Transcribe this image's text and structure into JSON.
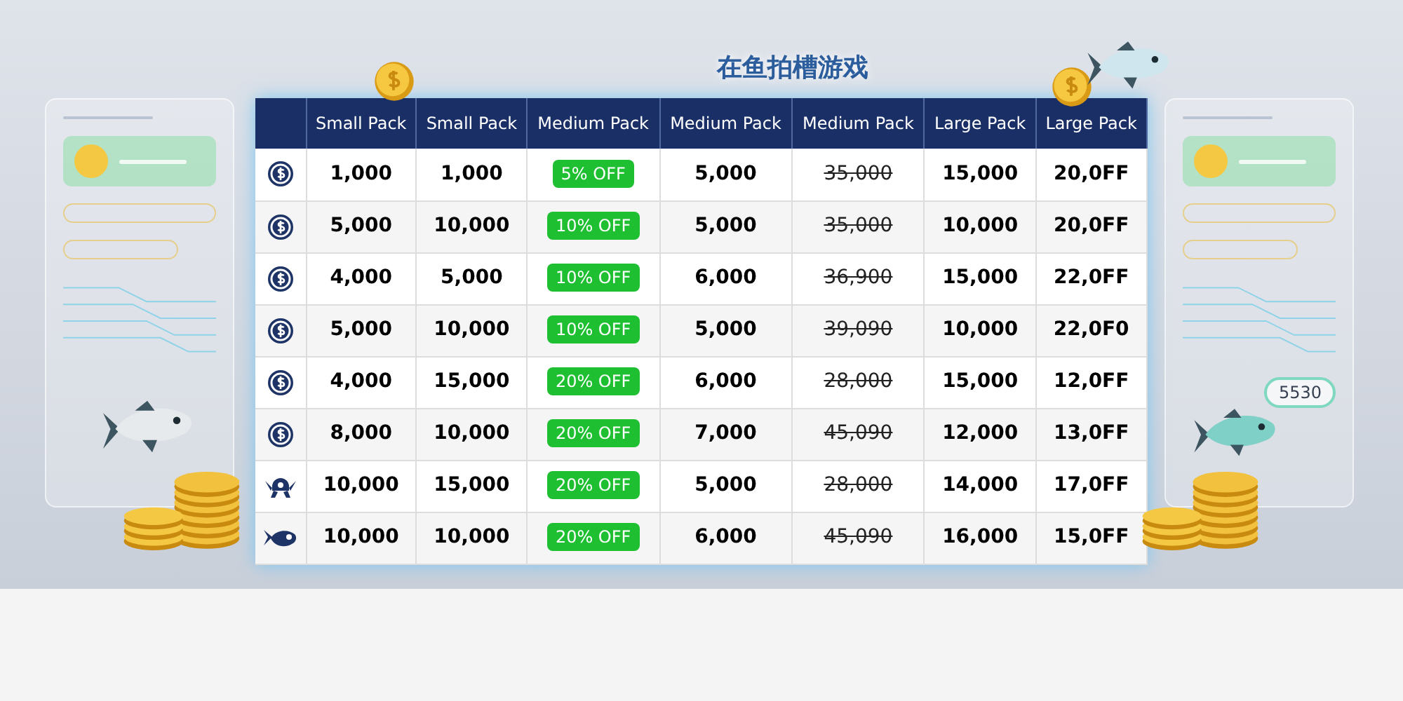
{
  "title": "在鱼拍槽游戏",
  "columns": [
    "Small Pack",
    "Small Pack",
    "Medium Pack",
    "Medium Pack",
    "Medium Pack",
    "Large Pack",
    "Large Pack"
  ],
  "rows": [
    {
      "kind": "coin",
      "small_1": "1,000",
      "small_2": "1,000",
      "discount": "5% OFF",
      "medium": "5,000",
      "medium_old": "35,000",
      "large_1": "15,000",
      "large_2": "20,0FF"
    },
    {
      "kind": "coin",
      "small_1": "5,000",
      "small_2": "10,000",
      "discount": "10% OFF",
      "medium": "5,000",
      "medium_old": "35,000",
      "large_1": "10,000",
      "large_2": "20,0FF"
    },
    {
      "kind": "coin",
      "small_1": "4,000",
      "small_2": "5,000",
      "discount": "10% OFF",
      "medium": "6,000",
      "medium_old": "36,900",
      "large_1": "15,000",
      "large_2": "22,0FF"
    },
    {
      "kind": "coin",
      "small_1": "5,000",
      "small_2": "10,000",
      "discount": "10% OFF",
      "medium": "5,000",
      "medium_old": "39,090",
      "large_1": "10,000",
      "large_2": "22,0F0"
    },
    {
      "kind": "coin",
      "small_1": "4,000",
      "small_2": "15,000",
      "discount": "20% OFF",
      "medium": "6,000",
      "medium_old": "28,000",
      "large_1": "15,000",
      "large_2": "12,0FF"
    },
    {
      "kind": "coin",
      "small_1": "8,000",
      "small_2": "10,000",
      "discount": "20% OFF",
      "medium": "7,000",
      "medium_old": "45,090",
      "large_1": "12,000",
      "large_2": "13,0FF"
    },
    {
      "kind": "creature",
      "small_1": "10,000",
      "small_2": "15,000",
      "discount": "20% OFF",
      "medium": "5,000",
      "medium_old": "28,000",
      "large_1": "14,000",
      "large_2": "17,0FF"
    },
    {
      "kind": "fish",
      "small_1": "10,000",
      "small_2": "10,000",
      "discount": "20% OFF",
      "medium": "6,000",
      "medium_old": "45,090",
      "large_1": "16,000",
      "large_2": "15,0FF"
    }
  ],
  "side_panel_reading": "5530"
}
